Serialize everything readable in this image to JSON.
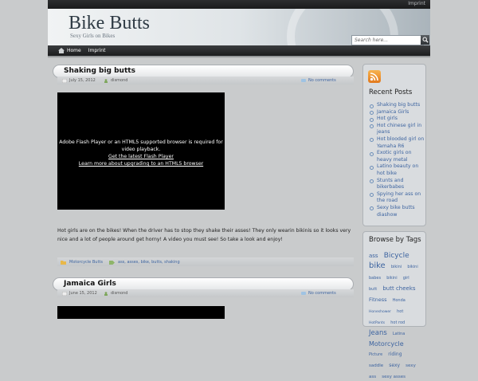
{
  "topbar": {
    "imprint": "Imprint"
  },
  "header": {
    "title": "Bike Butts",
    "tagline": "Sexy Girls on Bikes",
    "search_placeholder": "Search here..."
  },
  "nav": {
    "items": [
      "Home",
      "Imprint"
    ]
  },
  "posts": [
    {
      "title": "Shaking big butts",
      "date": "July 15, 2012",
      "author": "dismond",
      "comments": "No comments",
      "video": {
        "line1": "Adobe Flash Player or an HTML5 supported browser is required for",
        "line2": "video playback.",
        "link1": "Get the latest Flash Player",
        "link2": "Learn more about upgrading to an HTML5 browser"
      },
      "excerpt": "Hot girls are on the bikes! When the driver has to stop they shake their asses! They only wearin bikinis so it looks very nice and a lot of people around get horny! A video you must see! So take a look and enjoy!",
      "category": "Motorcycle Butts",
      "tags": "ass, asses, bike, butts, shaking"
    },
    {
      "title": "Jamaica Girls",
      "date": "June 15, 2012",
      "author": "dismond",
      "comments": "No comments"
    }
  ],
  "sidebar": {
    "recent_title": "Recent Posts",
    "recent_posts": [
      "Shaking big butts",
      "Jamaica Girls",
      "Hot girls",
      "Hot chinese girl in jeans",
      "Hot blooded girl on Yamaha R6",
      "Exotic girls on heavy metal",
      "Latino beauty on hot bike",
      "Stunts and bikerbabes",
      "Spying her ass on the road",
      "Sexy bike butts diashow"
    ],
    "tags_title": "Browse by Tags",
    "tags": [
      {
        "t": "ass",
        "s": 7
      },
      {
        "t": "Bicycle",
        "s": 9
      },
      {
        "t": "bike",
        "s": 10
      },
      {
        "t": "bikini",
        "s": 5
      },
      {
        "t": "bikini babes",
        "s": 5
      },
      {
        "t": "bikini",
        "s": 5
      },
      {
        "t": "girl",
        "s": 5
      },
      {
        "t": "butt",
        "s": 5
      },
      {
        "t": "butt cheeks",
        "s": 7
      },
      {
        "t": "Fitness",
        "s": 6.5
      },
      {
        "t": "Honda",
        "s": 5
      },
      {
        "t": "Honeshower",
        "s": 4.5
      },
      {
        "t": "hot",
        "s": 5
      },
      {
        "t": "HotPants",
        "s": 4.5
      },
      {
        "t": "hot rod",
        "s": 5
      },
      {
        "t": "Jeans",
        "s": 8.5
      },
      {
        "t": "Latina",
        "s": 5
      },
      {
        "t": "Motorcycle",
        "s": 8
      },
      {
        "t": "Picture",
        "s": 5
      },
      {
        "t": "riding",
        "s": 6
      },
      {
        "t": "saddle",
        "s": 5.5
      },
      {
        "t": "sexy",
        "s": 6
      },
      {
        "t": "sexy ass",
        "s": 5.5
      },
      {
        "t": "sexy asses",
        "s": 5.5
      }
    ]
  }
}
